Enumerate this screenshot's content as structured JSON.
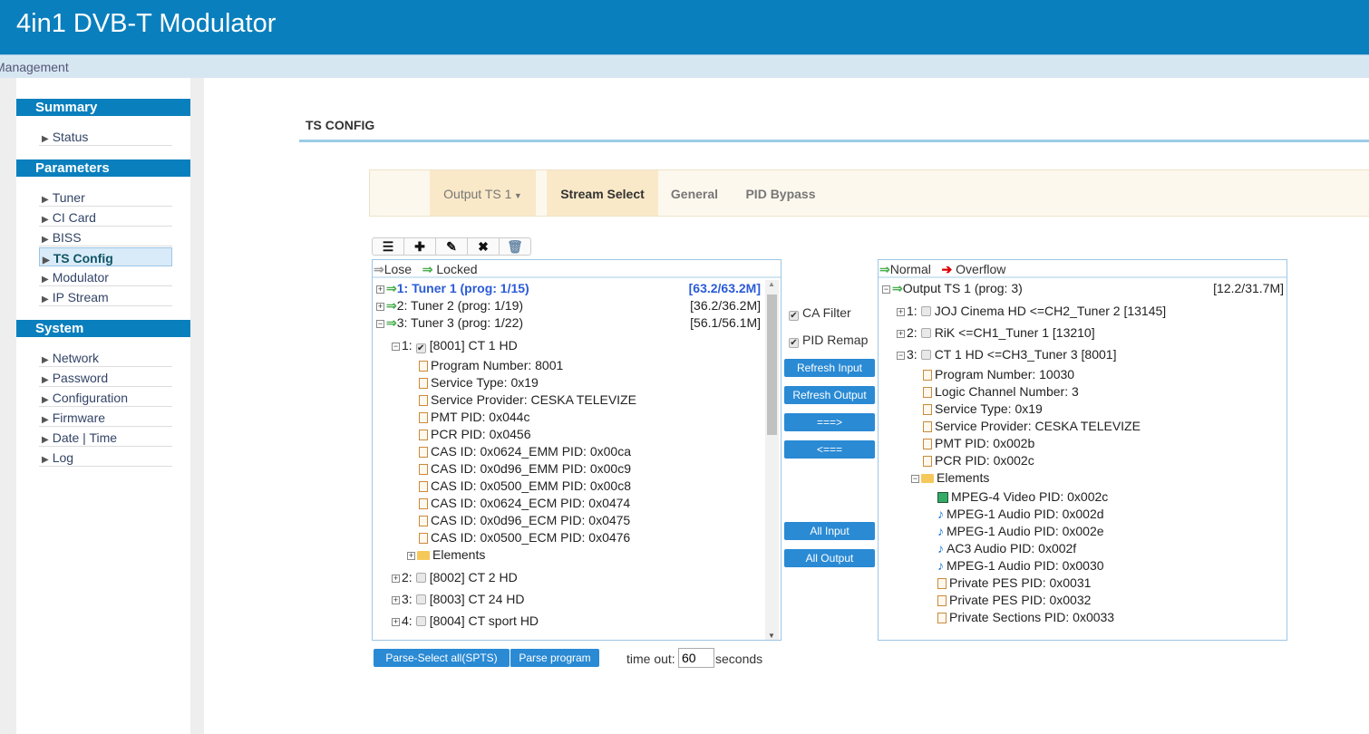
{
  "header": {
    "title": "4in1 DVB-T Modulator"
  },
  "nav": {
    "label": "Management"
  },
  "sidebar": {
    "sections": [
      {
        "title": "Summary",
        "items": [
          "Status"
        ]
      },
      {
        "title": "Parameters",
        "items": [
          "Tuner",
          "CI Card",
          "BISS",
          "TS Config",
          "Modulator",
          "IP Stream"
        ]
      },
      {
        "title": "System",
        "items": [
          "Network",
          "Password",
          "Configuration",
          "Firmware",
          "Date | Time",
          "Log"
        ]
      }
    ],
    "active": "TS Config"
  },
  "page": {
    "title": "TS CONFIG"
  },
  "tabs": [
    {
      "label": "Output TS 1",
      "dropdown": true
    },
    {
      "label": "Stream Select",
      "active": true
    },
    {
      "label": "General"
    },
    {
      "label": "PID Bypass"
    }
  ],
  "toolbar": [
    "list-icon",
    "plus-icon",
    "pencil-icon",
    "close-icon",
    "trash-icon"
  ],
  "left": {
    "legend": {
      "lose": "Lose",
      "locked": "Locked"
    },
    "rows": [
      {
        "d": 0,
        "pm": "+",
        "arrow": true,
        "text": "1: Tuner 1 (prog: 1/15)",
        "rate": "[63.2/63.2M]",
        "sel": true
      },
      {
        "d": 0,
        "pm": "+",
        "arrow": true,
        "text": "2: Tuner 2 (prog: 1/19)",
        "rate": "[36.2/36.2M]"
      },
      {
        "d": 0,
        "pm": "-",
        "arrow": true,
        "text": "3: Tuner 3 (prog: 1/22)",
        "rate": "[56.1/56.1M]"
      },
      {
        "d": 1,
        "pm": "-",
        "num": "1:",
        "cb": true,
        "checked": true,
        "text": "[8001] CT 1 HD"
      },
      {
        "d": 2,
        "icon": "doc",
        "text": "Program Number: 8001"
      },
      {
        "d": 2,
        "icon": "doc",
        "text": "Service Type: 0x19"
      },
      {
        "d": 2,
        "icon": "doc",
        "text": "Service Provider: CESKA TELEVIZE"
      },
      {
        "d": 2,
        "icon": "doc",
        "text": "PMT PID: 0x044c"
      },
      {
        "d": 2,
        "icon": "doc",
        "text": "PCR PID: 0x0456"
      },
      {
        "d": 2,
        "icon": "doc",
        "text": "CAS ID: 0x0624_EMM PID: 0x00ca"
      },
      {
        "d": 2,
        "icon": "doc",
        "text": "CAS ID: 0x0d96_EMM PID: 0x00c9"
      },
      {
        "d": 2,
        "icon": "doc",
        "text": "CAS ID: 0x0500_EMM PID: 0x00c8"
      },
      {
        "d": 2,
        "icon": "doc",
        "text": "CAS ID: 0x0624_ECM PID: 0x0474"
      },
      {
        "d": 2,
        "icon": "doc",
        "text": "CAS ID: 0x0d96_ECM PID: 0x0475"
      },
      {
        "d": 2,
        "icon": "doc",
        "text": "CAS ID: 0x0500_ECM PID: 0x0476"
      },
      {
        "d": 2,
        "pm": "+",
        "icon": "folder",
        "text": "Elements"
      },
      {
        "d": 1,
        "pm": "+",
        "num": "2:",
        "cb": true,
        "text": "[8002] CT 2 HD"
      },
      {
        "d": 1,
        "pm": "+",
        "num": "3:",
        "cb": true,
        "text": "[8003] CT 24 HD"
      },
      {
        "d": 1,
        "pm": "+",
        "num": "4:",
        "cb": true,
        "text": "[8004] CT sport HD"
      }
    ]
  },
  "middle": {
    "ca_filter": "CA Filter",
    "pid_remap": "PID Remap",
    "refresh_input": "Refresh Input",
    "refresh_output": "Refresh Output",
    "add": "===>",
    "remove": "<===",
    "all_input": "All Input",
    "all_output": "All Output"
  },
  "right": {
    "legend": {
      "normal": "Normal",
      "overflow": "Overflow"
    },
    "rows": [
      {
        "d": 0,
        "pm": "-",
        "arrow": true,
        "text": "Output TS 1 (prog: 3)",
        "rate": "[12.2/31.7M]"
      },
      {
        "d": 1,
        "pm": "+",
        "num": "1:",
        "cb": true,
        "text": "JOJ Cinema HD <=CH2_Tuner 2 [13145]"
      },
      {
        "d": 1,
        "pm": "+",
        "num": "2:",
        "cb": true,
        "text": "RiK <=CH1_Tuner 1 [13210]"
      },
      {
        "d": 1,
        "pm": "-",
        "num": "3:",
        "cb": true,
        "text": "CT 1 HD <=CH3_Tuner 3 [8001]"
      },
      {
        "d": 2,
        "icon": "doc",
        "text": "Program Number: 10030"
      },
      {
        "d": 2,
        "icon": "doc",
        "text": "Logic Channel Number: 3"
      },
      {
        "d": 2,
        "icon": "doc",
        "text": "Service Type: 0x19"
      },
      {
        "d": 2,
        "icon": "doc",
        "text": "Service Provider: CESKA TELEVIZE"
      },
      {
        "d": 2,
        "icon": "doc",
        "text": "PMT PID: 0x002b"
      },
      {
        "d": 2,
        "icon": "doc",
        "text": "PCR PID: 0x002c"
      },
      {
        "d": 2,
        "pm": "-",
        "icon": "folder",
        "text": "Elements"
      },
      {
        "d": 3,
        "icon": "video",
        "text": "MPEG-4 Video PID: 0x002c"
      },
      {
        "d": 3,
        "icon": "audio",
        "text": "MPEG-1 Audio PID: 0x002d"
      },
      {
        "d": 3,
        "icon": "audio",
        "text": "MPEG-1 Audio PID: 0x002e"
      },
      {
        "d": 3,
        "icon": "audio",
        "text": "AC3 Audio PID: 0x002f"
      },
      {
        "d": 3,
        "icon": "audio",
        "text": "MPEG-1 Audio PID: 0x0030"
      },
      {
        "d": 3,
        "icon": "doc",
        "text": "Private PES PID: 0x0031"
      },
      {
        "d": 3,
        "icon": "doc",
        "text": "Private PES PID: 0x0032"
      },
      {
        "d": 3,
        "icon": "doc",
        "text": "Private Sections PID: 0x0033"
      }
    ]
  },
  "bottom": {
    "parse_all": "Parse-Select all(SPTS)",
    "parse_program": "Parse program",
    "timeout_label": "time out:",
    "timeout_value": "60",
    "seconds": "seconds"
  }
}
